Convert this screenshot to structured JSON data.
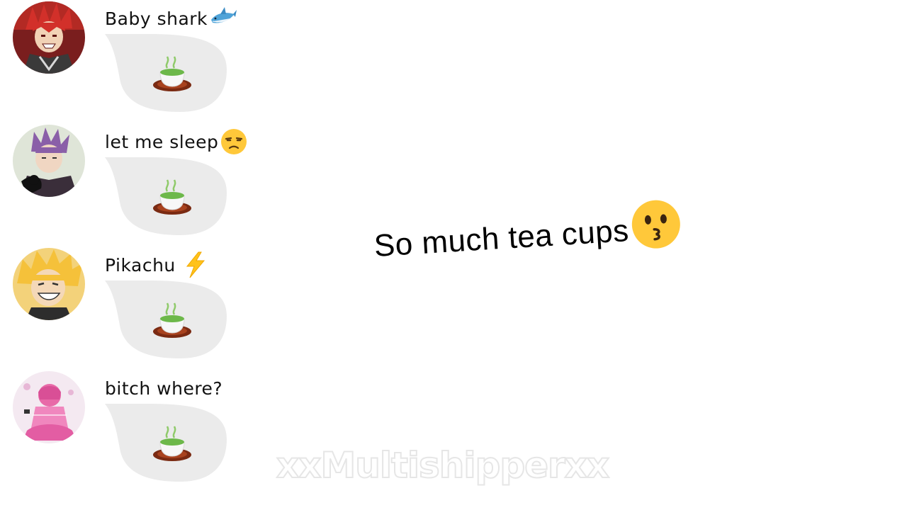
{
  "chats": [
    {
      "sender": "Baby shark",
      "name_emoji": "shark-icon",
      "avatar": "red-spiky-hair-character-avatar",
      "message_emoji": "teacup-icon"
    },
    {
      "sender": "let me sleep",
      "name_emoji": "unamused-face-icon",
      "avatar": "purple-hair-character-avatar",
      "message_emoji": "teacup-icon"
    },
    {
      "sender": "Pikachu",
      "name_emoji": "lightning-icon",
      "avatar": "blonde-grinning-character-avatar",
      "message_emoji": "teacup-icon"
    },
    {
      "sender": "bitch where?",
      "name_emoji": "",
      "avatar": "pink-character-avatar",
      "message_emoji": "teacup-icon"
    }
  ],
  "headline": {
    "text": "So much tea cups",
    "emoji": "kissing-face-icon"
  },
  "watermark": "xxMultishipperxx",
  "colors": {
    "bubble": "#ebebeb",
    "background": "#ffffff",
    "text": "#111111"
  }
}
